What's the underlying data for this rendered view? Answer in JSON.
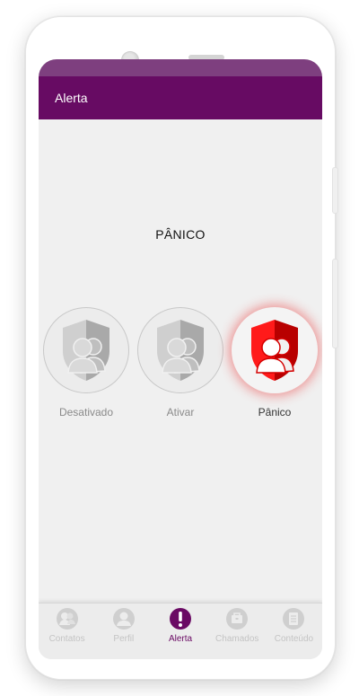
{
  "app_bar": {
    "title": "Alerta"
  },
  "main": {
    "heading": "PÂNICO",
    "modes": [
      {
        "label": "Desativado",
        "selected": false
      },
      {
        "label": "Ativar",
        "selected": false
      },
      {
        "label": "Pânico",
        "selected": true
      }
    ]
  },
  "bottom_nav": {
    "items": [
      {
        "label": "Contatos",
        "icon": "contacts-icon"
      },
      {
        "label": "Perfil",
        "icon": "profile-icon"
      },
      {
        "label": "Alerta",
        "icon": "alert-icon",
        "active": true
      },
      {
        "label": "Chamados",
        "icon": "calls-icon"
      },
      {
        "label": "Conteúdo",
        "icon": "content-icon"
      }
    ]
  },
  "colors": {
    "app_bar": "#670b63",
    "status_bar": "#7e3f7f",
    "panic": "#e60000",
    "active_nav": "#6a0a64"
  }
}
